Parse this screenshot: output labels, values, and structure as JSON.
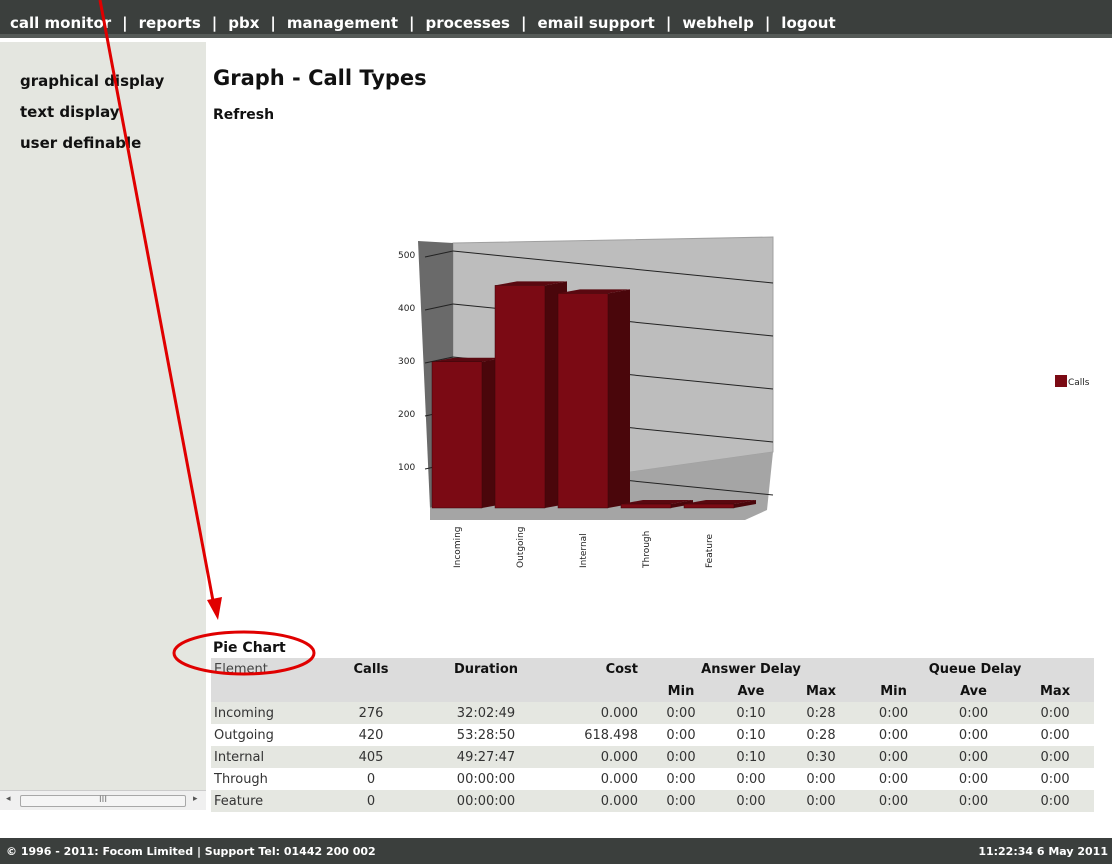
{
  "nav": {
    "items": [
      "call monitor",
      "reports",
      "pbx",
      "management",
      "processes",
      "email support",
      "webhelp",
      "logout"
    ],
    "separator": "|"
  },
  "sidebar": {
    "items": [
      "graphical display",
      "text display",
      "user definable"
    ]
  },
  "scrollbar": {
    "grip": "III",
    "left_arrow": "◂",
    "right_arrow": "▸"
  },
  "page": {
    "title": "Graph - Call Types",
    "refresh_label": "Refresh",
    "pie_chart_label": "Pie Chart"
  },
  "chart_data": {
    "type": "bar",
    "categories": [
      "Incoming",
      "Outgoing",
      "Internal",
      "Through",
      "Feature"
    ],
    "series": [
      {
        "name": "Calls",
        "values": [
          276,
          420,
          405,
          0,
          0
        ],
        "color": "#7b0a14"
      }
    ],
    "yticks": [
      "500",
      "400",
      "300",
      "200",
      "100"
    ],
    "ylim": [
      0,
      500
    ],
    "style": "3d",
    "legend_position": "right",
    "grid": true
  },
  "table": {
    "headers": {
      "element": "Element",
      "calls": "Calls",
      "duration": "Duration",
      "cost": "Cost",
      "answer_delay": "Answer Delay",
      "queue_delay": "Queue Delay"
    },
    "subheaders": [
      "Min",
      "Ave",
      "Max",
      "Min",
      "Ave",
      "Max"
    ],
    "rows": [
      [
        "Incoming",
        "276",
        "32:02:49",
        "0.000",
        "0:00",
        "0:10",
        "0:28",
        "0:00",
        "0:00",
        "0:00"
      ],
      [
        "Outgoing",
        "420",
        "53:28:50",
        "618.498",
        "0:00",
        "0:10",
        "0:28",
        "0:00",
        "0:00",
        "0:00"
      ],
      [
        "Internal",
        "405",
        "49:27:47",
        "0.000",
        "0:00",
        "0:10",
        "0:30",
        "0:00",
        "0:00",
        "0:00"
      ],
      [
        "Through",
        "0",
        "00:00:00",
        "0.000",
        "0:00",
        "0:00",
        "0:00",
        "0:00",
        "0:00",
        "0:00"
      ],
      [
        "Feature",
        "0",
        "00:00:00",
        "0.000",
        "0:00",
        "0:00",
        "0:00",
        "0:00",
        "0:00",
        "0:00"
      ]
    ]
  },
  "footer": {
    "copyright": "© 1996 - 2011: Focom Limited | Support Tel: 01442 200 002",
    "clock": "11:22:34 6 May 2011"
  },
  "colors": {
    "bar": "#7b0a14",
    "annotation": "#e00000",
    "nav_bg": "#3b3f3d",
    "sidebar_bg": "#e4e6e0"
  }
}
